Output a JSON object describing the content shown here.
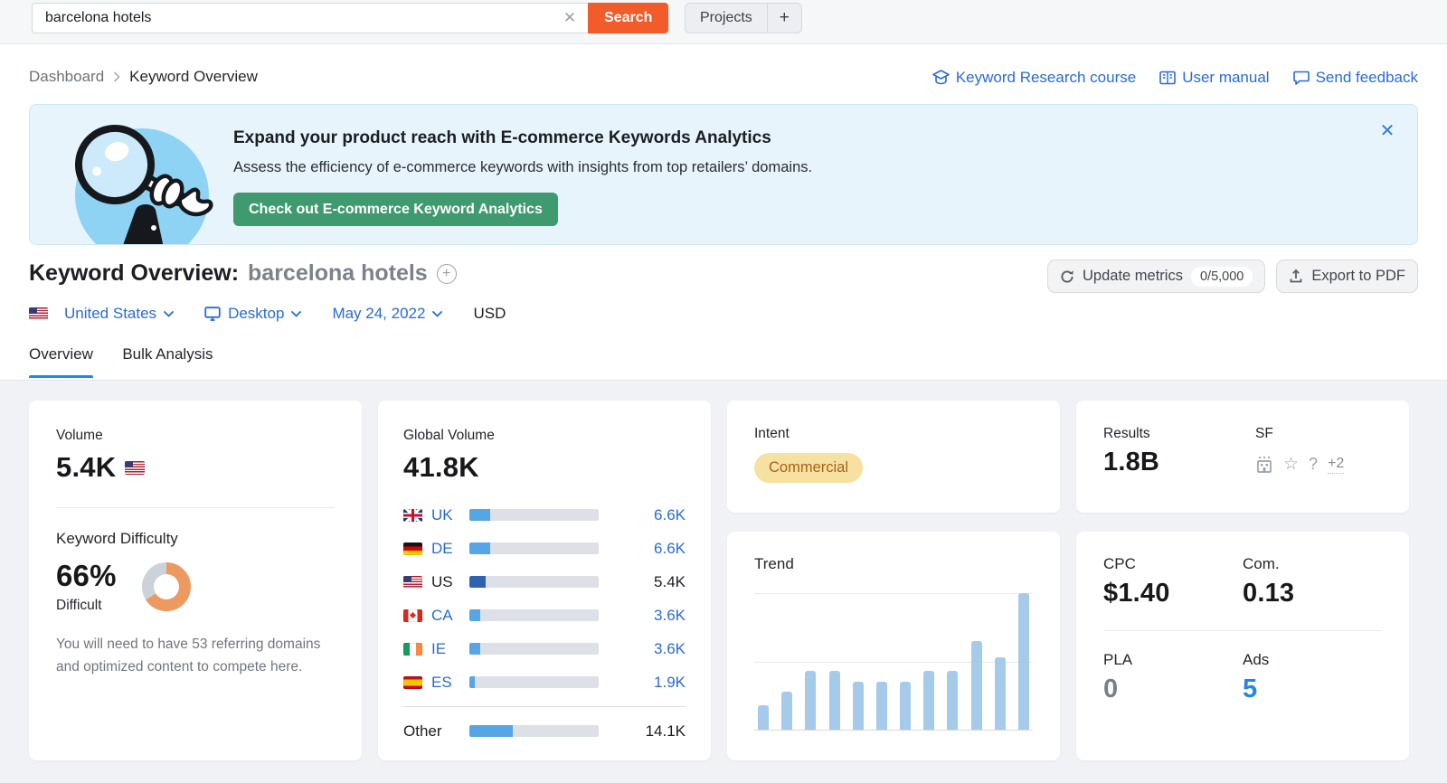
{
  "topbar": {
    "search_value": "barcelona hotels",
    "search_button": "Search",
    "clear_glyph": "✕",
    "projects_label": "Projects",
    "add_label": "+"
  },
  "breadcrumb": {
    "parent": "Dashboard",
    "current": "Keyword Overview"
  },
  "header_links": {
    "course": "Keyword Research course",
    "manual": "User manual",
    "feedback": "Send feedback"
  },
  "banner": {
    "title": "Expand your product reach with E-commerce Keywords Analytics",
    "subtitle": "Assess the efficiency of e-commerce keywords with insights from top retailers’ domains.",
    "cta": "Check out E-commerce Keyword Analytics",
    "close_glyph": "✕"
  },
  "page": {
    "title": "Keyword Overview:",
    "keyword": "barcelona hotels"
  },
  "actions": {
    "update_metrics": "Update metrics",
    "update_quota": "0/5,000",
    "export_pdf": "Export to PDF"
  },
  "filters": {
    "country": "United States",
    "device": "Desktop",
    "date": "May 24, 2022",
    "currency": "USD"
  },
  "tabs": [
    {
      "label": "Overview",
      "active": true
    },
    {
      "label": "Bulk Analysis",
      "active": false
    }
  ],
  "volume_card": {
    "label": "Volume",
    "value": "5.4K",
    "kd_label": "Keyword Difficulty",
    "kd_value": "66%",
    "kd_pct": 66,
    "kd_level": "Difficult",
    "kd_note": "You will need to have 53 referring domains and optimized content to compete here."
  },
  "global_volume": {
    "label": "Global Volume",
    "value": "41.8K",
    "rows": [
      {
        "flag": "uk",
        "code": "UK",
        "value": "6.6K",
        "pct": 15.8,
        "link": true
      },
      {
        "flag": "de",
        "code": "DE",
        "value": "6.6K",
        "pct": 15.8,
        "link": true
      },
      {
        "flag": "us",
        "code": "US",
        "value": "5.4K",
        "pct": 12.9,
        "link": false
      },
      {
        "flag": "ca",
        "code": "CA",
        "value": "3.6K",
        "pct": 8.6,
        "link": true
      },
      {
        "flag": "ie",
        "code": "IE",
        "value": "3.6K",
        "pct": 8.6,
        "link": true
      },
      {
        "flag": "es",
        "code": "ES",
        "value": "1.9K",
        "pct": 4.5,
        "link": true
      }
    ],
    "other": {
      "code": "Other",
      "value": "14.1K",
      "pct": 33.7,
      "link": false
    }
  },
  "intent_card": {
    "label": "Intent",
    "badge": "Commercial"
  },
  "results_card": {
    "label": "Results",
    "value": "1.8B",
    "sf_label": "SF",
    "sf_more": "+2"
  },
  "trend_card": {
    "label": "Trend",
    "chart_data": {
      "type": "bar",
      "values": [
        18,
        28,
        43,
        43,
        35,
        35,
        35,
        43,
        43,
        65,
        53,
        100
      ],
      "ylim": [
        0,
        100
      ],
      "gridlines_pct": [
        0,
        50,
        100
      ]
    }
  },
  "cpc_card": {
    "cpc_label": "CPC",
    "cpc": "$1.40",
    "com_label": "Com.",
    "com": "0.13",
    "pla_label": "PLA",
    "pla": "0",
    "ads_label": "Ads",
    "ads": "5"
  },
  "icons": {
    "search_clear": "x-clear-icon",
    "academy": "academy-cap-icon",
    "manual": "open-book-icon",
    "feedback": "speech-bubble-icon",
    "refresh": "refresh-icon",
    "export": "export-up-icon",
    "device": "monitor-icon",
    "chevron": "chevron-down-icon",
    "add_keyword": "plus-circle-icon",
    "sf_hotels": "hotels-pack-icon",
    "sf_reviews": "star-icon",
    "sf_paa": "question-mark-icon"
  },
  "colors": {
    "accent_orange": "#f25c2a",
    "link_blue": "#2a6bd2",
    "kd_orange": "#ec9a5f",
    "bar_light": "#56a5e4",
    "bar_dark": "#2f62b0",
    "trend_bar": "#a6cae9",
    "intent_bg": "#f7e1a0",
    "intent_text": "#a6621a",
    "banner_bg": "#e8f4fc",
    "cta_green": "#3f9a70",
    "ads_blue": "#2187e8"
  }
}
